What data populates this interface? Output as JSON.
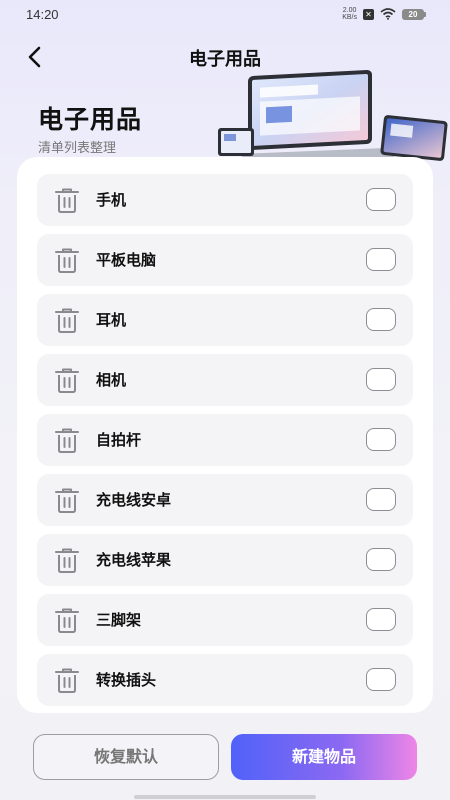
{
  "status_bar": {
    "time": "14:20",
    "net_speed_value": "2.00",
    "net_speed_unit": "KB/s",
    "battery": "20"
  },
  "nav": {
    "title": "电子用品"
  },
  "hero": {
    "title": "电子用品",
    "subtitle": "清单列表整理"
  },
  "items": [
    {
      "label": "手机",
      "checked": false
    },
    {
      "label": "平板电脑",
      "checked": false
    },
    {
      "label": "耳机",
      "checked": false
    },
    {
      "label": "相机",
      "checked": false
    },
    {
      "label": "自拍杆",
      "checked": false
    },
    {
      "label": "充电线安卓",
      "checked": false
    },
    {
      "label": "充电线苹果",
      "checked": false
    },
    {
      "label": "三脚架",
      "checked": false
    },
    {
      "label": "转换插头",
      "checked": false
    }
  ],
  "buttons": {
    "reset": "恢复默认",
    "new": "新建物品"
  },
  "colors": {
    "accent_start": "#5062f9",
    "accent_end": "#ee86e6"
  }
}
